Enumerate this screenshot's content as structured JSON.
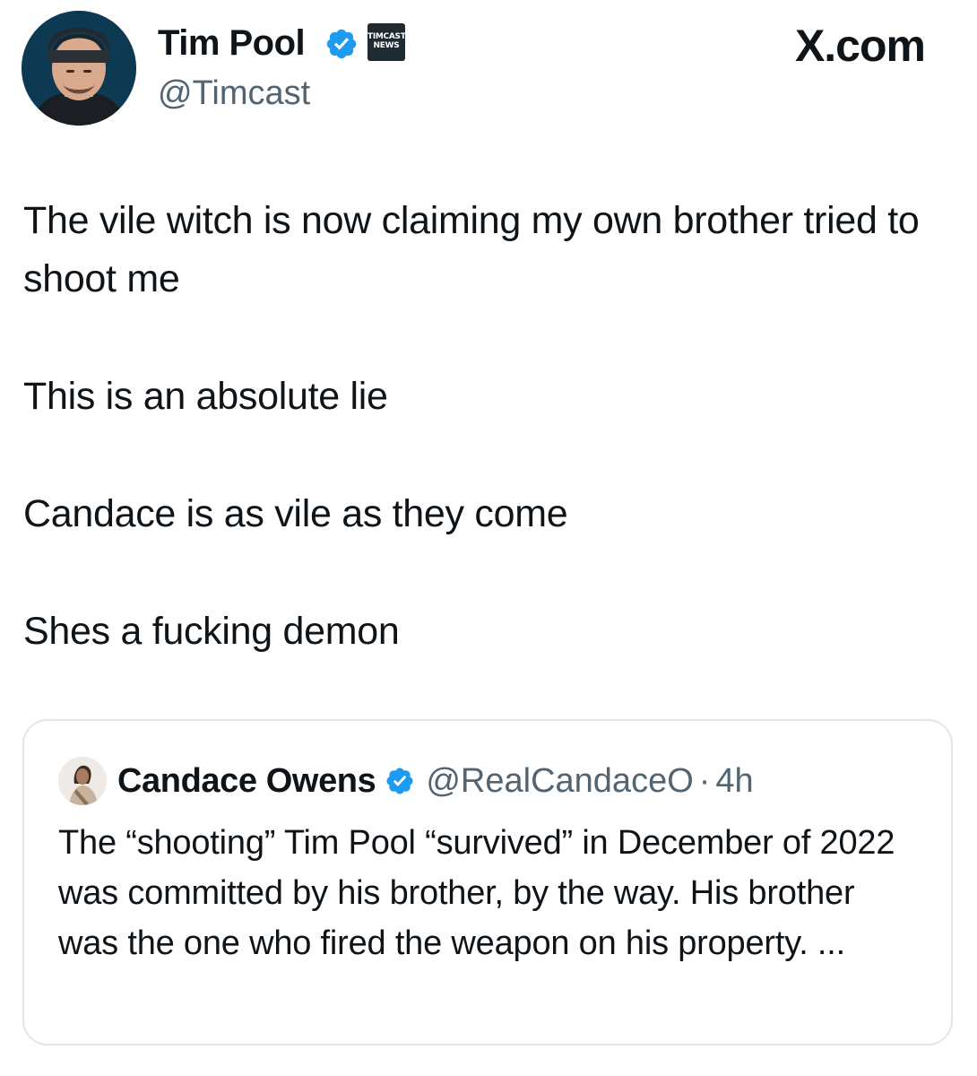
{
  "post": {
    "author_name": "Tim Pool",
    "author_handle": "@Timcast",
    "affiliate_badge_lines": [
      "TIMCAST",
      "NEWS"
    ],
    "site_label": "X.com",
    "paragraphs": [
      "The vile witch is now claiming my own brother tried to shoot me",
      "This is an absolute lie",
      "Candace is as vile as they come",
      "Shes a fucking demon"
    ]
  },
  "quoted_post": {
    "author_name": "Candace Owens",
    "author_handle": "@RealCandaceO",
    "separator": "·",
    "timestamp": "4h",
    "text": "The “shooting” Tim Pool “survived” in December of 2022 was committed by his brother, by the way. His brother was the one who fired the weapon on his property. ..."
  },
  "icons": {
    "verified": "verified-badge-icon",
    "affiliate": "timcast-news-badge-icon"
  },
  "colors": {
    "text_primary": "#0f1419",
    "text_secondary": "#536471",
    "verified_blue": "#1d9bf0",
    "card_border": "#e1e6ea"
  }
}
